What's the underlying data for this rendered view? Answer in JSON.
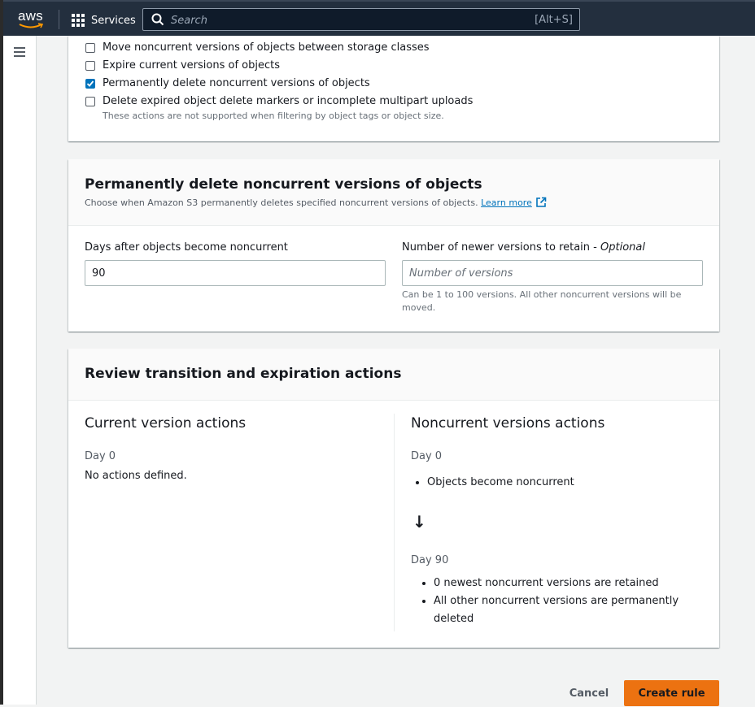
{
  "nav": {
    "logo_text": "aws",
    "services_label": "Services",
    "search_placeholder": "Search",
    "search_shortcut": "[Alt+S]"
  },
  "actions": {
    "items": [
      {
        "label": "Move noncurrent versions of objects between storage classes",
        "checked": false
      },
      {
        "label": "Expire current versions of objects",
        "checked": false
      },
      {
        "label": "Permanently delete noncurrent versions of objects",
        "checked": true
      },
      {
        "label": "Delete expired object delete markers or incomplete multipart uploads",
        "checked": false
      }
    ],
    "hint": "These actions are not supported when filtering by object tags or object size."
  },
  "permanent_delete": {
    "title": "Permanently delete noncurrent versions of objects",
    "description": "Choose when Amazon S3 permanently deletes specified noncurrent versions of objects.",
    "learn_more": "Learn more",
    "days_label": "Days after objects become noncurrent",
    "days_value": "90",
    "versions_label": "Number of newer versions to retain - ",
    "versions_optional": "Optional",
    "versions_placeholder": "Number of versions",
    "versions_hint": "Can be 1 to 100 versions. All other noncurrent versions will be moved."
  },
  "review": {
    "title": "Review transition and expiration actions",
    "current": {
      "title": "Current version actions",
      "day": "Day 0",
      "text": "No actions defined."
    },
    "noncurrent": {
      "title": "Noncurrent versions actions",
      "day0": "Day 0",
      "day0_items": [
        "Objects become noncurrent"
      ],
      "arrow": "↓",
      "day90": "Day 90",
      "day90_items": [
        "0 newest noncurrent versions are retained",
        "All other noncurrent versions are permanently deleted"
      ]
    }
  },
  "footer": {
    "cancel": "Cancel",
    "create": "Create rule"
  },
  "colors": {
    "navbar": "#232f3e",
    "primary_button": "#ec7211",
    "checkbox_checked": "#0073bb",
    "link": "#0073bb"
  }
}
